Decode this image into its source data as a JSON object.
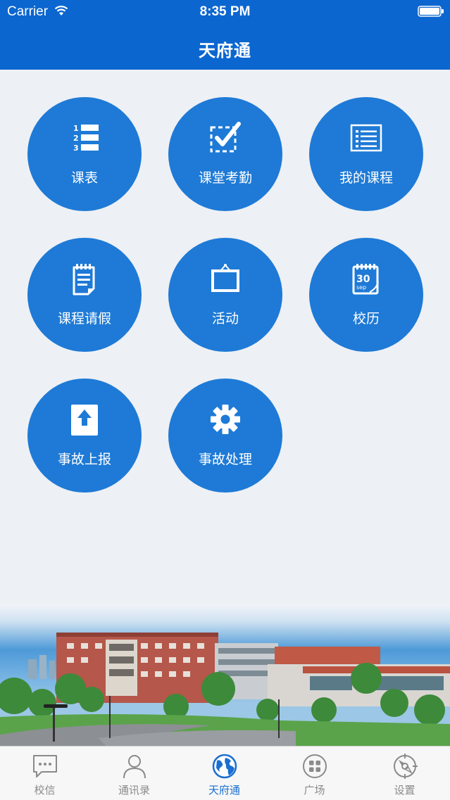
{
  "status_bar": {
    "carrier": "Carrier",
    "time": "8:35 PM"
  },
  "header": {
    "title": "天府通"
  },
  "tiles": [
    {
      "label": "课表",
      "icon": "numbered-list-icon"
    },
    {
      "label": "课堂考勤",
      "icon": "attendance-check-icon"
    },
    {
      "label": "我的课程",
      "icon": "course-list-icon"
    },
    {
      "label": "课程请假",
      "icon": "notepad-icon"
    },
    {
      "label": "活动",
      "icon": "easel-board-icon"
    },
    {
      "label": "校历",
      "icon": "calendar-icon"
    },
    {
      "label": "事故上报",
      "icon": "upload-report-icon"
    },
    {
      "label": "事故处理",
      "icon": "gear-icon"
    }
  ],
  "calendar_icon_text": {
    "day": "30",
    "month": "sep"
  },
  "tabbar": {
    "active": "天府通",
    "items": [
      {
        "label": "校信",
        "icon": "chat-bubble-icon"
      },
      {
        "label": "通讯录",
        "icon": "person-icon"
      },
      {
        "label": "天府通",
        "icon": "globe-icon"
      },
      {
        "label": "广场",
        "icon": "grid-circle-icon"
      },
      {
        "label": "设置",
        "icon": "compass-icon"
      }
    ]
  },
  "colors": {
    "header": "#0b66d0",
    "tile": "#1e7ad6",
    "active_tab": "#1a6fd0",
    "inactive_tab": "#8a8a8a"
  }
}
